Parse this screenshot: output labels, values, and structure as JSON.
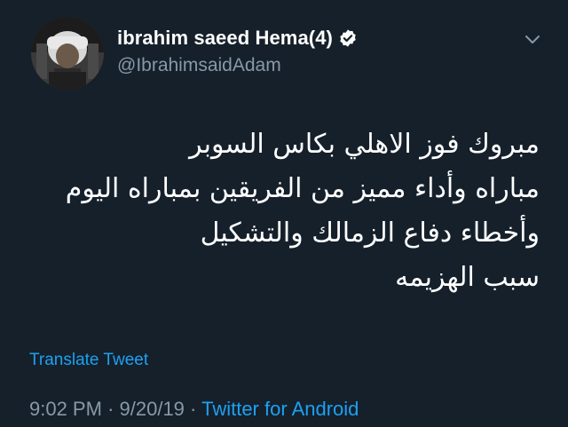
{
  "tweet": {
    "author": {
      "display_name": "ibrahim saeed Hema(4)",
      "handle": "@IbrahimsaidAdam",
      "verified": true
    },
    "text_lines": [
      "مبروك فوز الاهلي بكاس السوبر",
      "مباراه وأداء مميز من الفريقين بمباراه اليوم",
      "وأخطاء دفاع الزمالك والتشكيل",
      "سبب الهزيمه"
    ],
    "translate_label": "Translate Tweet",
    "time": "9:02 PM",
    "date": "9/20/19",
    "separator": "·",
    "source": "Twitter for Android"
  },
  "colors": {
    "background": "#15202b",
    "text_primary": "#ffffff",
    "text_secondary": "#8899a6",
    "accent": "#1da1f2"
  },
  "icons": {
    "verified": "verified-badge-icon",
    "menu": "chevron-down-icon"
  }
}
